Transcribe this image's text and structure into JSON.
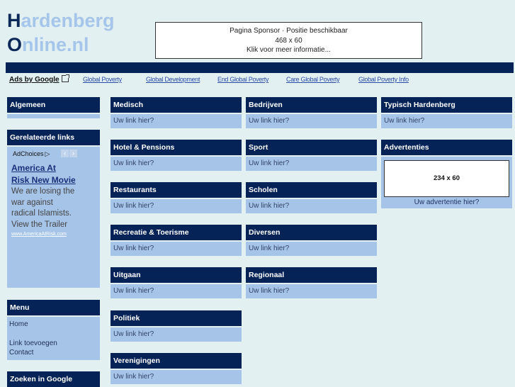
{
  "logo": {
    "line1_initial": "H",
    "line1_rest": "ardenberg",
    "line2_initial": "O",
    "line2_rest": "nline.nl"
  },
  "sponsor": {
    "line1": "Pagina Sponsor · Positie beschikbaar",
    "line2": "468 x 60",
    "line3": "Klik voor meer informatie..."
  },
  "ads_bar": {
    "label": "Ads by Google",
    "icon": "external-link-icon",
    "links": [
      "Global Poverty",
      "Global Development",
      "End Global Poverty",
      "Care Global Poverty",
      "Global Poverty Info"
    ]
  },
  "sidebar": {
    "algemeen": {
      "title": "Algemeen"
    },
    "gerelateerde": {
      "title": "Gerelateerde links",
      "adchoices": "AdChoices",
      "adchoices_icon": "adchoices-triangle-icon",
      "prev_icon": "chevron-left-icon",
      "next_icon": "chevron-right-icon",
      "prev_label": "‹",
      "next_label": "›",
      "ad_title_1": "America At",
      "ad_title_2": "Risk New Movie",
      "ad_text_1": "We are losing the",
      "ad_text_2": "war against",
      "ad_text_3": "radical Islamists.",
      "ad_text_4": "View the Trailer",
      "ad_url": "www.AmericaAtRisk.com"
    },
    "menu": {
      "title": "Menu",
      "items": [
        "Home",
        "Link toevoegen",
        "Contact"
      ]
    },
    "zoeken": {
      "title": "Zoeken in Google"
    }
  },
  "categories": {
    "link_text": "Uw link hier?",
    "col1": [
      "Medisch",
      "Hotel & Pensions",
      "Restaurants",
      "Recreatie & Toerisme",
      "Uitgaan",
      "Politiek",
      "Verenigingen"
    ],
    "col2": [
      "Bedrijven",
      "Sport",
      "Scholen",
      "Diversen",
      "Regionaal"
    ],
    "col3": [
      "Typisch Hardenberg"
    ]
  },
  "advertenties": {
    "title": "Advertenties",
    "banner": "234 x 60",
    "link": "Uw advertentie hier?"
  }
}
